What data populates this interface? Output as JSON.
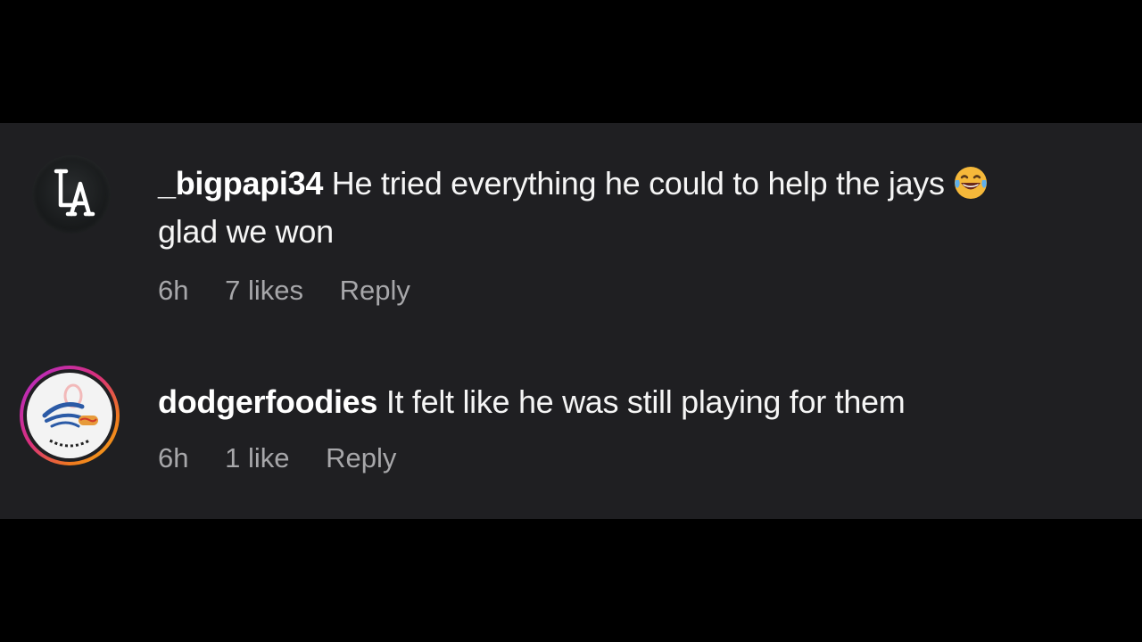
{
  "comments": [
    {
      "username": "_bigpapi34",
      "text_line1": "He tried everything he could to help the jays",
      "emoji": "face-with-tears-of-joy",
      "text_line2": "glad we won",
      "time": "6h",
      "likes": "7 likes",
      "reply_label": "Reply",
      "avatar_icon": "la-logo-icon"
    },
    {
      "username": "dodgerfoodies",
      "text": "It felt like he was still playing for them",
      "time": "6h",
      "likes": "1 like",
      "reply_label": "Reply",
      "avatar_icon": "dodgers-foodies-logo-icon",
      "avatar_ring_colors": [
        "#b02ad0",
        "#d9307a",
        "#f07a1e",
        "#f6b31a"
      ]
    }
  ],
  "colors": {
    "page_background": "#000000",
    "panel_background": "#1f1f22",
    "text_primary": "#f5f5f5",
    "text_secondary": "#a7a7aa"
  }
}
